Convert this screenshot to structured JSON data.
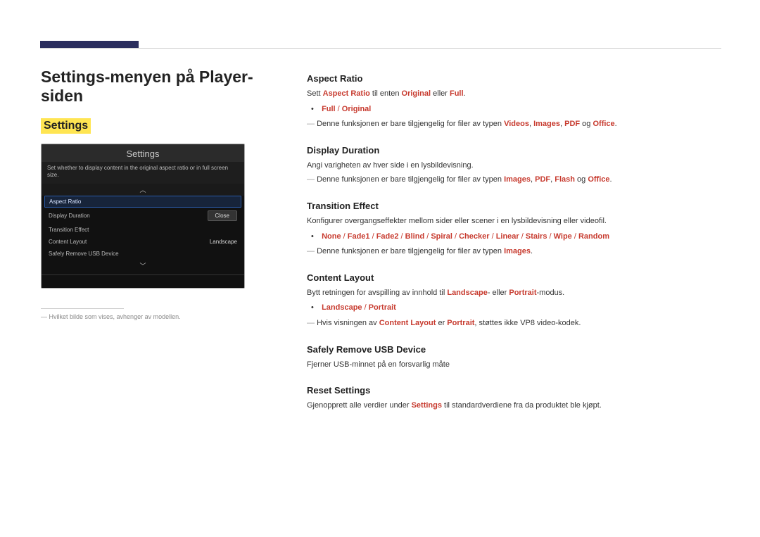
{
  "page": {
    "title": "Settings-menyen på Player-siden",
    "label": "Settings",
    "caption": "Hvilket bilde som vises, avhenger av modellen."
  },
  "panel": {
    "title": "Settings",
    "desc": "Set whether to display content in the original aspect ratio or in full screen size.",
    "arrow_up": "︿",
    "arrow_down": "﹀",
    "close": "Close",
    "rows": {
      "aspect": "Aspect Ratio",
      "duration": "Display Duration",
      "transition": "Transition Effect",
      "layout": "Content Layout",
      "layout_value": "Landscape",
      "usb": "Safely Remove USB Device"
    }
  },
  "sections": {
    "aspect": {
      "title": "Aspect Ratio",
      "line1_a": "Sett ",
      "line1_b": "Aspect Ratio",
      "line1_c": " til enten ",
      "line1_d": "Original",
      "line1_e": " eller ",
      "line1_f": "Full",
      "line1_g": ".",
      "opts_a": "Full",
      "sep": " / ",
      "opts_b": "Original",
      "note_a": "Denne funksjonen er bare tilgjengelig for filer av typen ",
      "note_b": "Videos",
      "note_c": "Images",
      "note_d": "PDF",
      "note_e": "Office",
      "comma": ", ",
      "og": " og ",
      "period": "."
    },
    "duration": {
      "title": "Display Duration",
      "p1": "Angi varigheten av hver side i en lysbildevisning.",
      "note_a": "Denne funksjonen er bare tilgjengelig for filer av typen ",
      "n1": "Images",
      "n2": "PDF",
      "n3": "Flash",
      "n4": "Office"
    },
    "transition": {
      "title": "Transition Effect",
      "p1": "Konfigurer overgangseffekter mellom sider eller scener i en lysbildevisning eller videofil.",
      "opts": [
        "None",
        "Fade1",
        "Fade2",
        "Blind",
        "Spiral",
        "Checker",
        "Linear",
        "Stairs",
        "Wipe",
        "Random"
      ],
      "note_a": "Denne funksjonen er bare tilgjengelig for filer av typen ",
      "n1": "Images"
    },
    "layout": {
      "title": "Content Layout",
      "p1_a": "Bytt retningen for avspilling av innhold til ",
      "p1_b": "Landscape",
      "p1_c": "- eller ",
      "p1_d": "Portrait",
      "p1_e": "-modus.",
      "opts_a": "Landscape",
      "opts_b": "Portrait",
      "note_a": "Hvis visningen av ",
      "note_b": "Content Layout",
      "note_c": " er ",
      "note_d": "Portrait",
      "note_e": ", støttes ikke VP8 video-kodek."
    },
    "usb": {
      "title": "Safely Remove USB Device",
      "p1": "Fjerner USB-minnet på en forsvarlig måte"
    },
    "reset": {
      "title": "Reset Settings",
      "p1_a": "Gjenopprett alle verdier under ",
      "p1_b": "Settings",
      "p1_c": " til standardverdiene fra da produktet ble kjøpt."
    }
  }
}
